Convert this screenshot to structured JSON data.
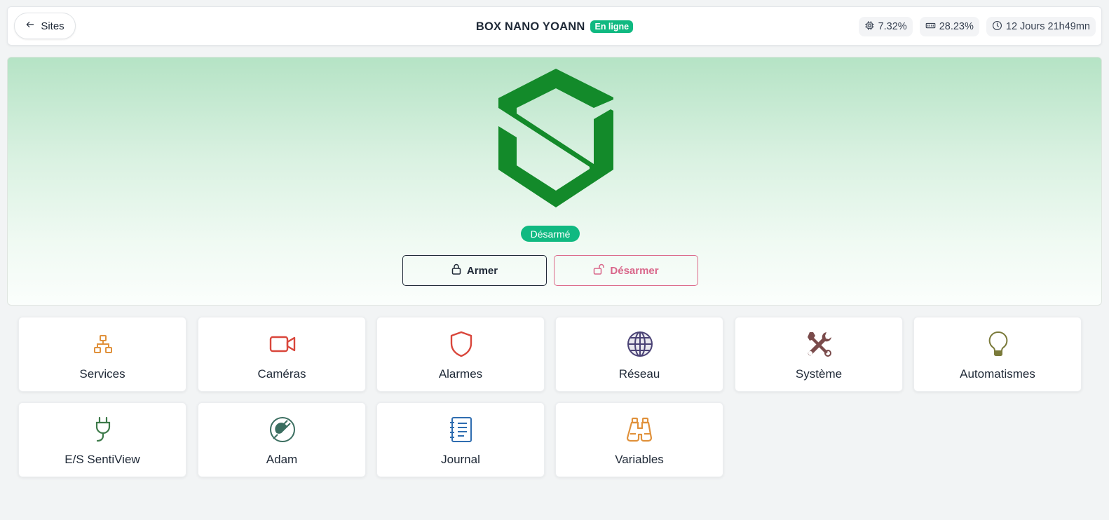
{
  "header": {
    "back_label": "Sites",
    "site_title": "BOX NANO YOANN",
    "online_badge": "En ligne",
    "stats": {
      "cpu": "7.32%",
      "memory": "28.23%",
      "uptime": "12 Jours 21h49mn"
    }
  },
  "hero": {
    "status": "Désarmé",
    "arm_label": "Armer",
    "disarm_label": "Désarmer"
  },
  "tiles": [
    {
      "label": "Services",
      "icon": "network-icon",
      "color": "#e0913b"
    },
    {
      "label": "Caméras",
      "icon": "video-camera-icon",
      "color": "#d9463b"
    },
    {
      "label": "Alarmes",
      "icon": "shield-icon",
      "color": "#d9463b"
    },
    {
      "label": "Réseau",
      "icon": "globe-icon",
      "color": "#4a4275"
    },
    {
      "label": "Système",
      "icon": "tools-icon",
      "color": "#7a4b4b"
    },
    {
      "label": "Automatismes",
      "icon": "lightbulb-icon",
      "color": "#7a7a3a"
    },
    {
      "label": "E/S SentiView",
      "icon": "plug-icon",
      "color": "#3d7a4a"
    },
    {
      "label": "Adam",
      "icon": "power-plug-circle-icon",
      "color": "#3b6e60"
    },
    {
      "label": "Journal",
      "icon": "journal-icon",
      "color": "#2f6db0"
    },
    {
      "label": "Variables",
      "icon": "binoculars-icon",
      "color": "#e0913b"
    }
  ],
  "colors": {
    "logo_green": "#138a2a",
    "success": "#10b981",
    "disarm_pink": "#d9668a"
  }
}
